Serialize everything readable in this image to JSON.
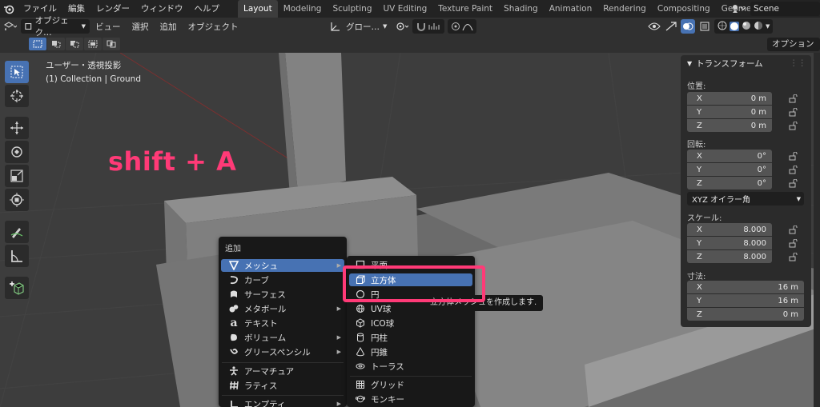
{
  "topbar": {
    "menus": [
      "ファイル",
      "編集",
      "レンダー",
      "ウィンドウ",
      "ヘルプ"
    ],
    "workspaces": [
      "Layout",
      "Modeling",
      "Sculpting",
      "UV Editing",
      "Texture Paint",
      "Shading",
      "Animation",
      "Rendering",
      "Compositing",
      "Geometry"
    ],
    "active_workspace": "Layout",
    "scene": "Scene"
  },
  "header": {
    "mode": "オブジェク…",
    "menus": [
      "ビュー",
      "選択",
      "追加",
      "オブジェクト"
    ],
    "orientation": "グロー…",
    "options_label": "オプション"
  },
  "viewport": {
    "view_name": "ユーザー・透視投影",
    "collection": "(1) Collection | Ground",
    "annotation": "shift + A"
  },
  "npanel": {
    "title": "トランスフォーム",
    "location_label": "位置:",
    "location": [
      {
        "axis": "X",
        "value": "0 m"
      },
      {
        "axis": "Y",
        "value": "0 m"
      },
      {
        "axis": "Z",
        "value": "0 m"
      }
    ],
    "rotation_label": "回転:",
    "rotation": [
      {
        "axis": "X",
        "value": "0°"
      },
      {
        "axis": "Y",
        "value": "0°"
      },
      {
        "axis": "Z",
        "value": "0°"
      }
    ],
    "rotation_mode": "XYZ オイラー角",
    "scale_label": "スケール:",
    "scale": [
      {
        "axis": "X",
        "value": "8.000"
      },
      {
        "axis": "Y",
        "value": "8.000"
      },
      {
        "axis": "Z",
        "value": "8.000"
      }
    ],
    "dimensions_label": "寸法:",
    "dimensions": [
      {
        "axis": "X",
        "value": "16 m"
      },
      {
        "axis": "Y",
        "value": "16 m"
      },
      {
        "axis": "Z",
        "value": "0 m"
      }
    ]
  },
  "add_menu": {
    "title": "追加",
    "items": [
      {
        "label": "メッシュ",
        "icon": "mesh-icon",
        "submenu": true
      },
      {
        "label": "カーブ",
        "icon": "curve-icon",
        "submenu": false
      },
      {
        "label": "サーフェス",
        "icon": "surface-icon",
        "submenu": false
      },
      {
        "label": "メタボール",
        "icon": "metaball-icon",
        "submenu": true
      },
      {
        "label": "テキスト",
        "icon": "text-icon",
        "submenu": false
      },
      {
        "label": "ボリューム",
        "icon": "volume-icon",
        "submenu": true
      },
      {
        "label": "グリースペンシル",
        "icon": "grease-pencil-icon",
        "submenu": true
      },
      {
        "label": "アーマチュア",
        "icon": "armature-icon",
        "submenu": false
      },
      {
        "label": "ラティス",
        "icon": "lattice-icon",
        "submenu": false
      },
      {
        "label": "エンプティ",
        "icon": "empty-icon",
        "submenu": true
      }
    ]
  },
  "mesh_menu": {
    "items": [
      {
        "label": "平面",
        "icon": "plane-icon"
      },
      {
        "label": "立方体",
        "icon": "cube-icon"
      },
      {
        "label": "円",
        "icon": "circle-icon"
      },
      {
        "label": "UV球",
        "icon": "uv-sphere-icon"
      },
      {
        "label": "ICO球",
        "icon": "ico-sphere-icon"
      },
      {
        "label": "円柱",
        "icon": "cylinder-icon"
      },
      {
        "label": "円錐",
        "icon": "cone-icon"
      },
      {
        "label": "トーラス",
        "icon": "torus-icon"
      },
      {
        "label": "グリッド",
        "icon": "grid-icon"
      },
      {
        "label": "モンキー",
        "icon": "monkey-icon"
      }
    ],
    "tooltip": "立方体メッシュを作成します."
  },
  "colors": {
    "accent": "#4772b3",
    "annotation": "#ff3a77"
  }
}
